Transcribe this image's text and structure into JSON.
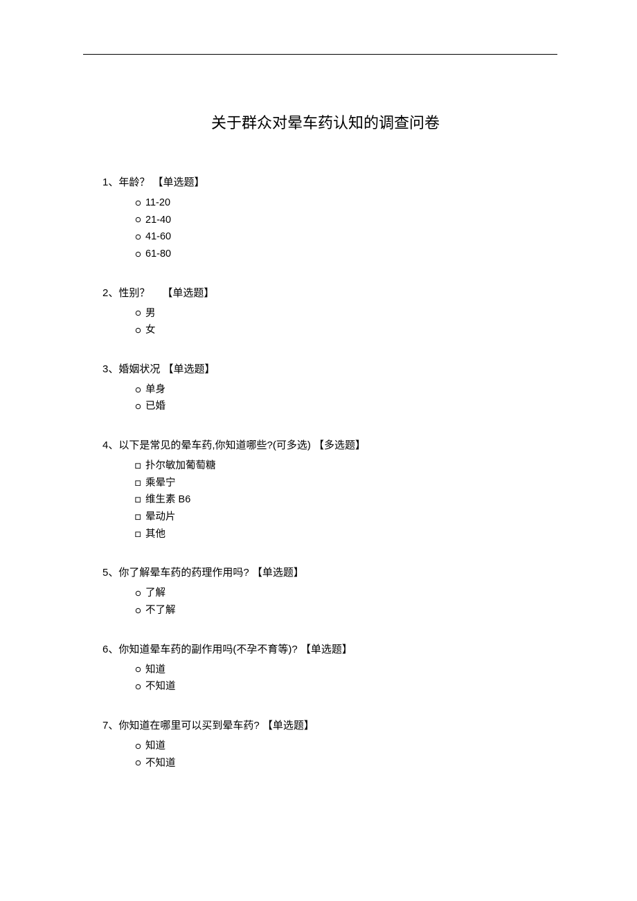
{
  "title": "关于群众对晕车药认知的调查问卷",
  "markers": {
    "radio": "○",
    "checkbox": "□"
  },
  "type_labels": {
    "single": "【单选题】",
    "multi": "【多选题】"
  },
  "questions": [
    {
      "num": "1",
      "text": "年龄？",
      "type": "single",
      "gap": false,
      "options": [
        {
          "label": "11-20"
        },
        {
          "label": "21-40"
        },
        {
          "label": "41-60"
        },
        {
          "label": "61-80"
        }
      ]
    },
    {
      "num": "2",
      "text": "性别？",
      "type": "single",
      "gap": true,
      "options": [
        {
          "label": "男"
        },
        {
          "label": "女"
        }
      ]
    },
    {
      "num": "3",
      "text": "婚姻状况",
      "type": "single",
      "gap": false,
      "options": [
        {
          "label": "单身"
        },
        {
          "label": "已婚"
        }
      ]
    },
    {
      "num": "4",
      "text": "以下是常见的晕车药,你知道哪些?(可多选)",
      "type": "multi",
      "gap": false,
      "options": [
        {
          "label": "扑尔敏加葡萄糖"
        },
        {
          "label": "乘晕宁"
        },
        {
          "label": "维生素 B6"
        },
        {
          "label": "晕动片"
        },
        {
          "label": "其他"
        }
      ]
    },
    {
      "num": "5",
      "text": "你了解晕车药的药理作用吗?",
      "type": "single",
      "gap": false,
      "options": [
        {
          "label": "了解"
        },
        {
          "label": "不了解"
        }
      ]
    },
    {
      "num": "6",
      "text": "你知道晕车药的副作用吗(不孕不育等)?",
      "type": "single",
      "gap": false,
      "options": [
        {
          "label": "知道"
        },
        {
          "label": "不知道"
        }
      ]
    },
    {
      "num": "7",
      "text": "你知道在哪里可以买到晕车药?",
      "type": "single",
      "gap": false,
      "options": [
        {
          "label": "知道"
        },
        {
          "label": "不知道"
        }
      ]
    }
  ]
}
